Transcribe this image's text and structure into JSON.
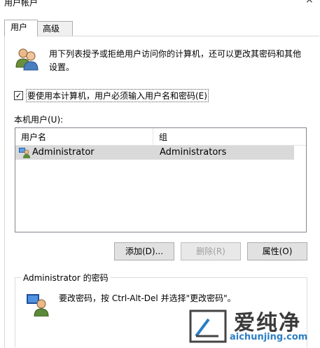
{
  "window": {
    "title": "用户帐户",
    "close_glyph": "×"
  },
  "tabs": [
    {
      "label": "用户",
      "active": true
    },
    {
      "label": "高级",
      "active": false
    }
  ],
  "intro_text": "用下列表授予或拒绝用户访问你的计算机，还可以更改其密码和其他设置。",
  "require_login": {
    "label": "要使用本计算机，用户必须输入用户名和密码(E)",
    "checked": true,
    "check_glyph": "✓"
  },
  "local_users": {
    "label": "本机用户(U):",
    "columns": [
      "用户名",
      "组"
    ],
    "rows": [
      {
        "name": "Administrator",
        "group": "Administrators",
        "selected": true
      }
    ]
  },
  "buttons": {
    "add": "添加(D)...",
    "remove": "删除(R)",
    "properties": "属性(O)"
  },
  "password_group": {
    "title": "Administrator 的密码",
    "text": "要改密码，按 Ctrl-Alt-Del 并选择\"更改密码\"。"
  },
  "watermark": {
    "text": "爱纯净",
    "url": "aichunjing.com"
  },
  "colors": {
    "selected_row": "#d9d9d9",
    "accent": "#2b7ec4"
  }
}
